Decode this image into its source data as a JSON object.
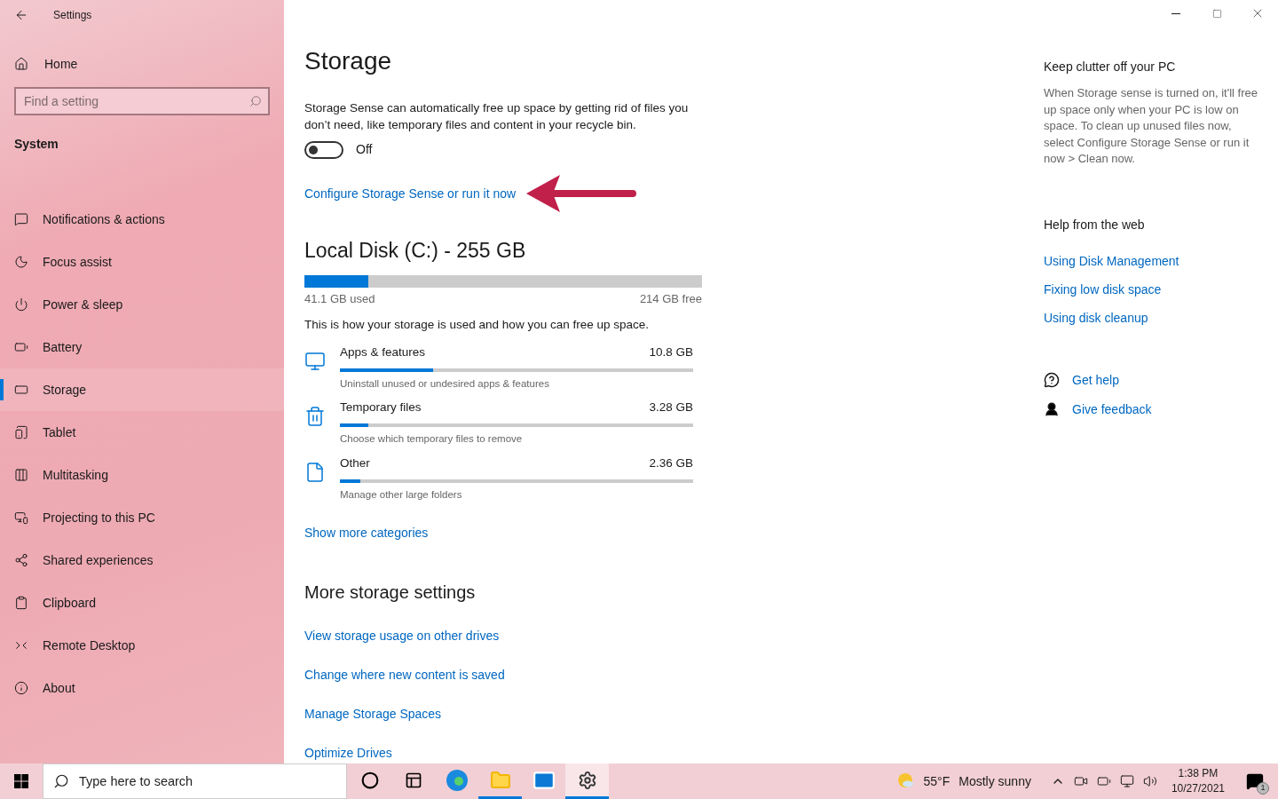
{
  "window": {
    "title": "Settings"
  },
  "sidebar": {
    "home": "Home",
    "search": {
      "placeholder": "Find a setting"
    },
    "section": "System",
    "items": [
      {
        "label": "Notifications & actions",
        "selected": false
      },
      {
        "label": "Focus assist",
        "selected": false
      },
      {
        "label": "Power & sleep",
        "selected": false
      },
      {
        "label": "Battery",
        "selected": false
      },
      {
        "label": "Storage",
        "selected": true
      },
      {
        "label": "Tablet",
        "selected": false
      },
      {
        "label": "Multitasking",
        "selected": false
      },
      {
        "label": "Projecting to this PC",
        "selected": false
      },
      {
        "label": "Shared experiences",
        "selected": false
      },
      {
        "label": "Clipboard",
        "selected": false
      },
      {
        "label": "Remote Desktop",
        "selected": false
      },
      {
        "label": "About",
        "selected": false
      }
    ]
  },
  "page": {
    "title": "Storage",
    "storage_sense": {
      "description": "Storage Sense can automatically free up space by getting rid of files you don’t need, like temporary files and content in your recycle bin.",
      "toggle": {
        "on": false,
        "label": "Off"
      },
      "link": "Configure Storage Sense or run it now"
    },
    "disk": {
      "title": "Local Disk (C:) - 255 GB",
      "level": 0.161,
      "used": "41.1 GB used",
      "free": "214 GB free",
      "description": "This is how your storage is used and how you can free up space."
    },
    "categories": [
      {
        "name": "Apps & features",
        "size": "10.8 GB",
        "hint": "Uninstall unused or undesired apps & features",
        "level": 0.264
      },
      {
        "name": "Temporary files",
        "size": "3.28 GB",
        "hint": "Choose which temporary files to remove",
        "level": 0.08
      },
      {
        "name": "Other",
        "size": "2.36 GB",
        "hint": "Manage other large folders",
        "level": 0.058
      }
    ],
    "more_link": "Show more categories",
    "more_settings": {
      "title": "More storage settings",
      "links": [
        "View storage usage on other drives",
        "Change where new content is saved",
        "Manage Storage Spaces",
        "Optimize Drives"
      ]
    }
  },
  "aside": {
    "clutter": {
      "title": "Keep clutter off your PC",
      "text": "When Storage sense is turned on, it'll free up space only when your PC is low on space. To clean up unused files now, select Configure Storage Sense or run it now > Clean now."
    },
    "help": {
      "title": "Help from the web",
      "links": [
        "Using Disk Management",
        "Fixing low disk space",
        "Using disk cleanup"
      ]
    },
    "get_help": "Get help",
    "feedback": "Give feedback"
  },
  "taskbar": {
    "search": {
      "placeholder": "Type here to search"
    },
    "apps": [
      {
        "running": false,
        "selected": false
      },
      {
        "running": false,
        "selected": false
      },
      {
        "running": false,
        "selected": false
      },
      {
        "running": true,
        "selected": false
      },
      {
        "running": false,
        "selected": false
      },
      {
        "running": true,
        "selected": true
      }
    ],
    "weather": {
      "temperature": "55°F",
      "condition": "Mostly sunny"
    },
    "time": "1:38 PM",
    "date": "10/27/2021",
    "notifications": "1"
  }
}
